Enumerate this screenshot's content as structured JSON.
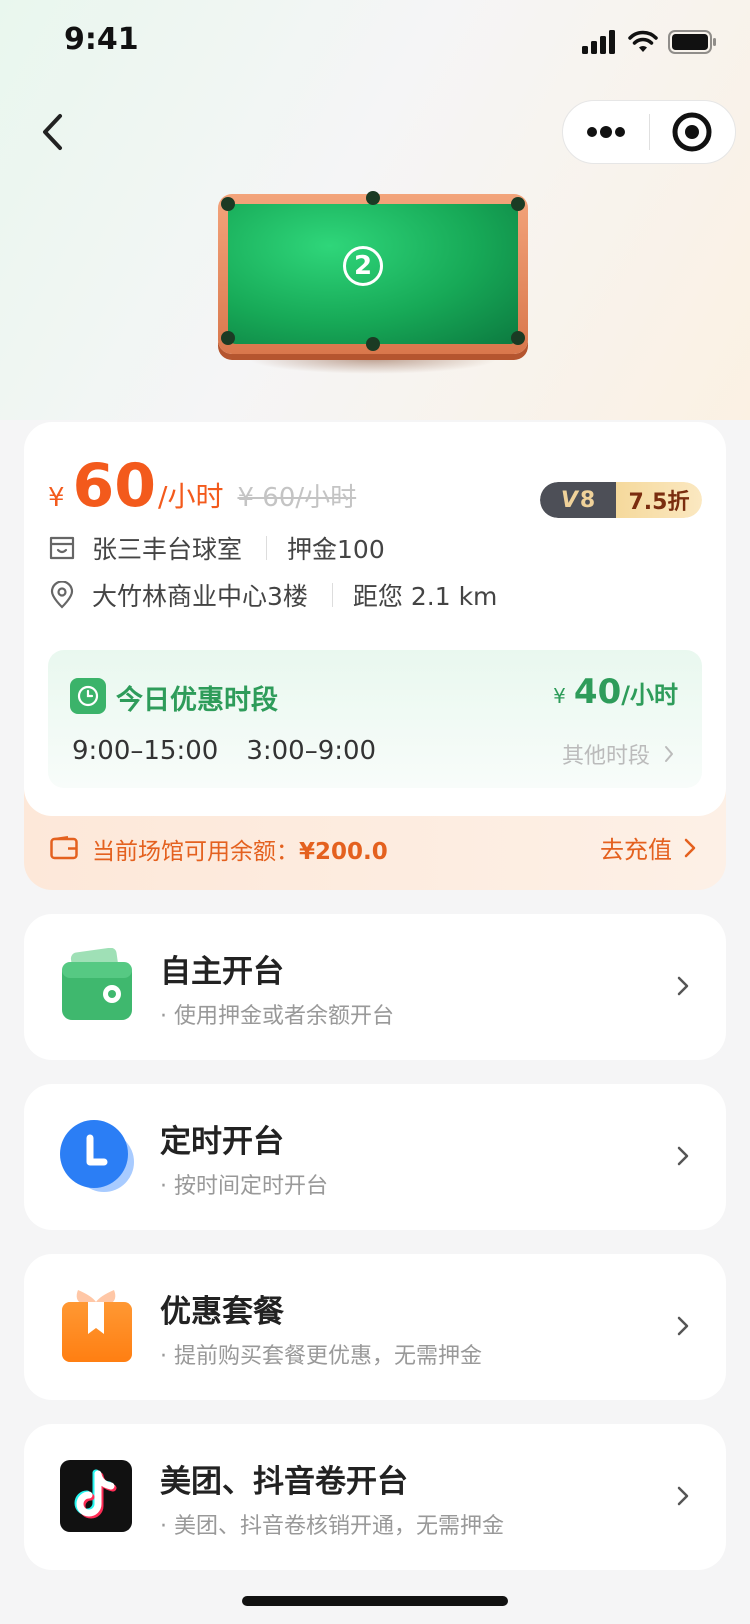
{
  "status_bar": {
    "time": "9:41"
  },
  "table": {
    "number": "2"
  },
  "price": {
    "symbol": "¥",
    "value": "60",
    "unit": "/小时",
    "original": "¥ 60/小时"
  },
  "vip": {
    "level": "8",
    "discount": "7.5折"
  },
  "venue": {
    "name": "张三丰台球室",
    "deposit": "押金100",
    "address": "大竹林商业中心3楼",
    "distance": "距您 2.1 km"
  },
  "discount": {
    "title": "今日优惠时段",
    "symbol": "¥",
    "price": "40",
    "unit": "/小时",
    "time_1": "9:00–15:00",
    "time_2": "3:00–9:00",
    "other": "其他时段"
  },
  "balance": {
    "label": "当前场馆可用余额：",
    "amount": "¥200.0",
    "action": "去充值"
  },
  "options": [
    {
      "title": "自主开台",
      "subtitle": "· 使用押金或者余额开台",
      "icon": "wallet-icon"
    },
    {
      "title": "定时开台",
      "subtitle": "· 按时间定时开台",
      "icon": "clock-icon"
    },
    {
      "title": "优惠套餐",
      "subtitle": "· 提前购买套餐更优惠，无需押金",
      "icon": "gift-icon"
    },
    {
      "title": "美团、抖音卷开台",
      "subtitle": "· 美团、抖音卷核销开通，无需押金",
      "icon": "douyin-icon"
    }
  ],
  "colors": {
    "accent_orange": "#f35a1c",
    "accent_green": "#2e9c5a",
    "felt_green": "#17a957"
  }
}
